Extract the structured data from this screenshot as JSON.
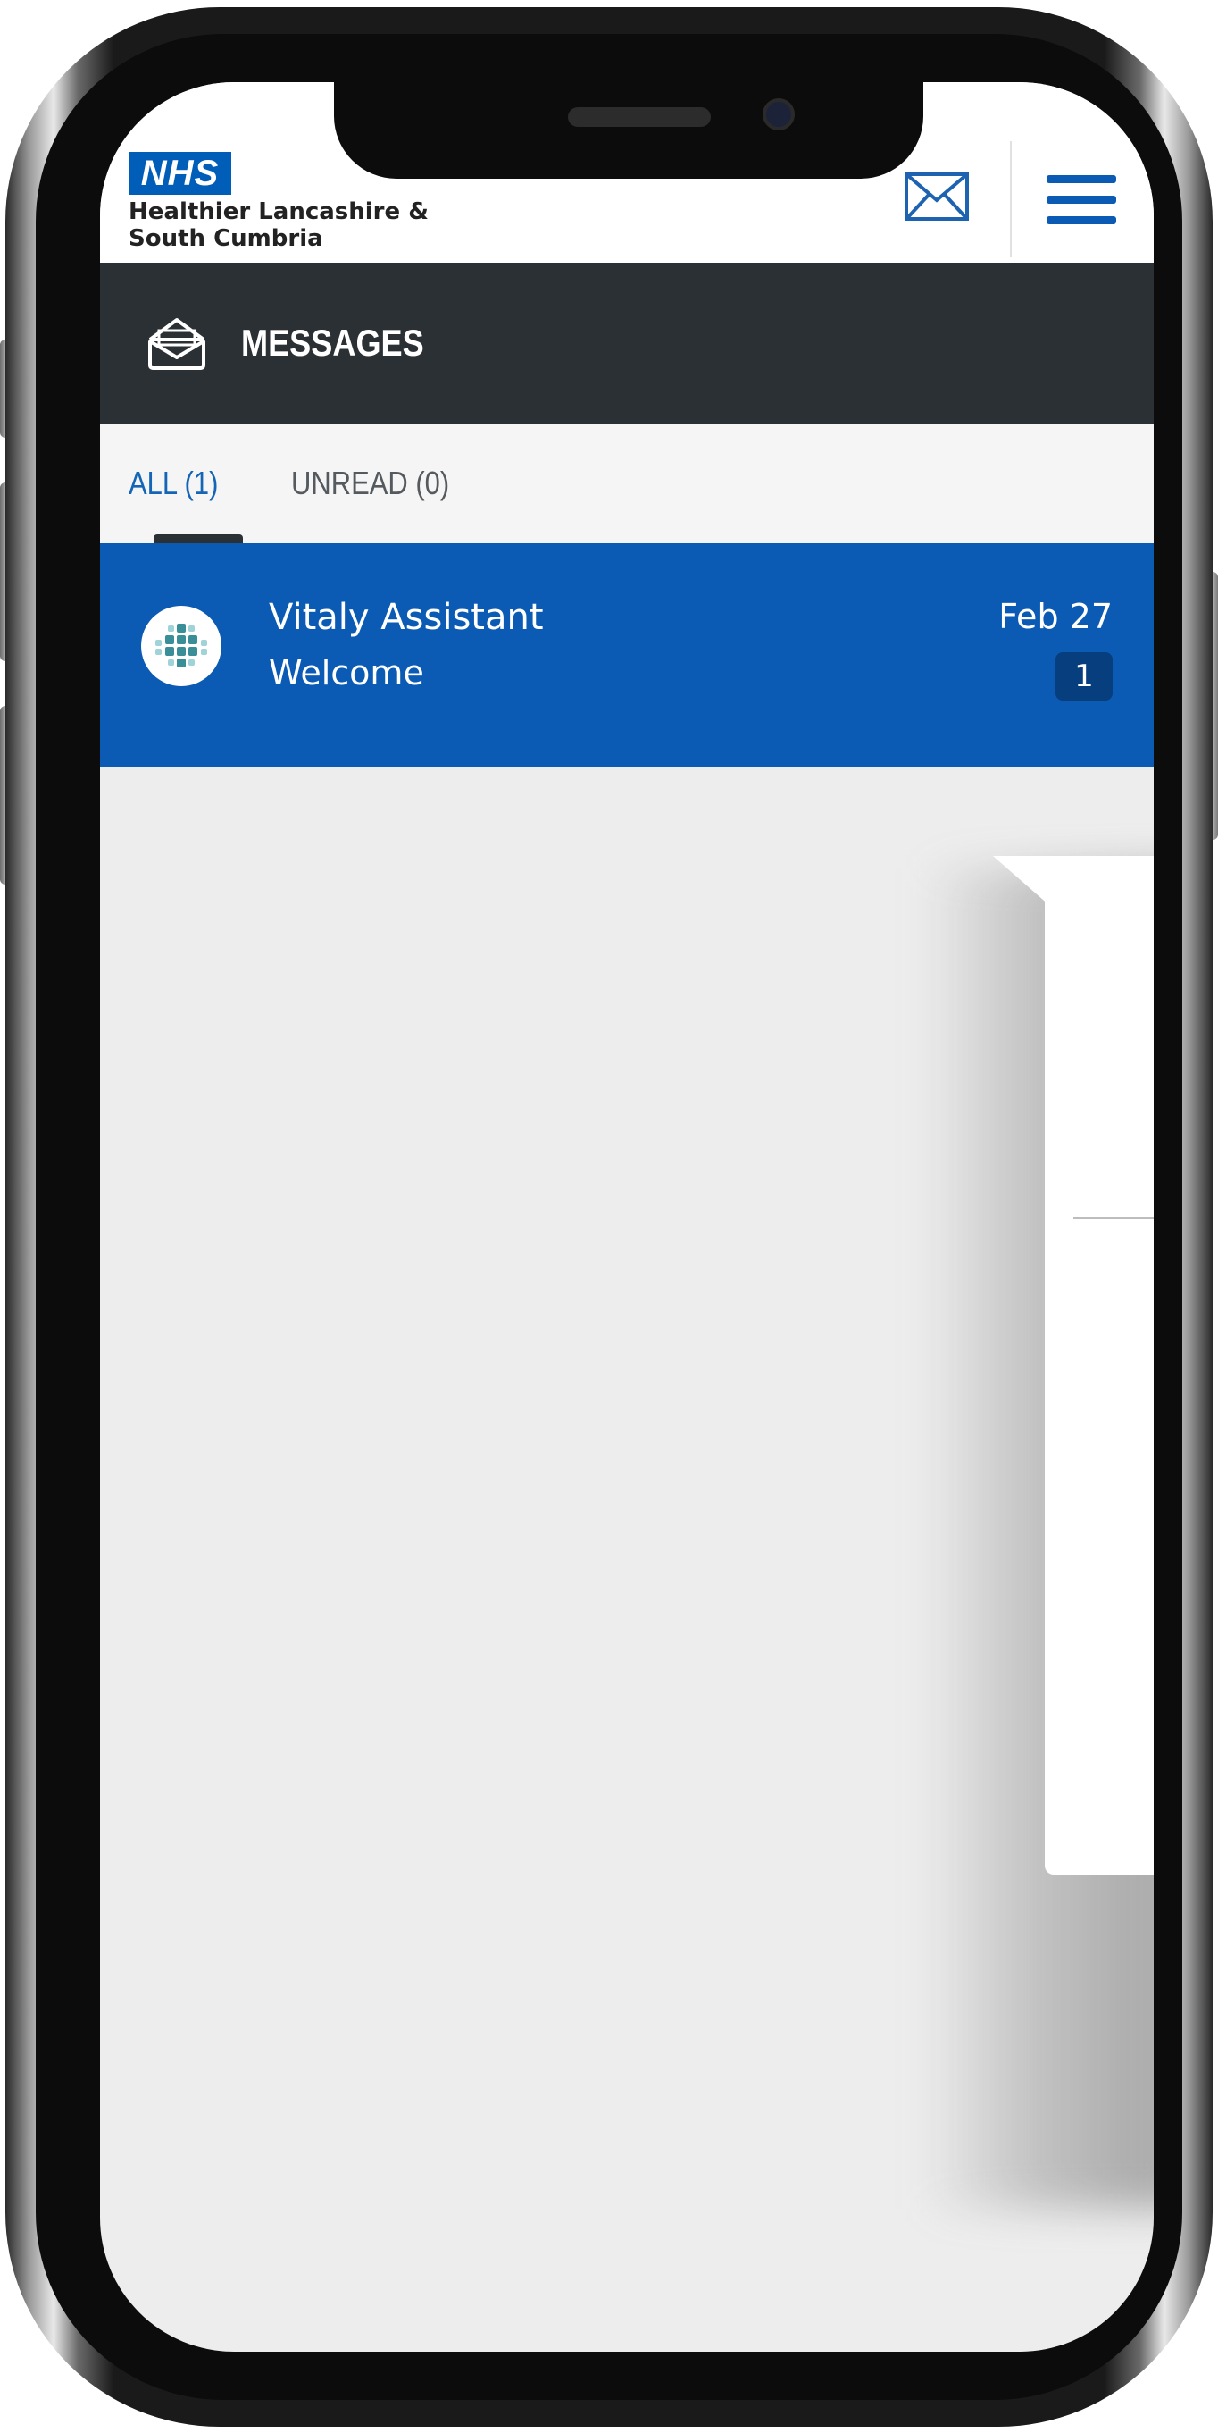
{
  "header": {
    "logo_text": "NHS",
    "org_name_line1": "Healthier Lancashire &",
    "org_name_line2": "South Cumbria",
    "mail_icon": "envelope-icon",
    "menu_icon": "hamburger-menu-icon"
  },
  "title_bar": {
    "icon": "open-envelope-icon",
    "title": "MESSAGES"
  },
  "tabs": [
    {
      "label": "ALL (1)",
      "active": true
    },
    {
      "label": "UNREAD (0)",
      "active": false
    }
  ],
  "messages": [
    {
      "sender": "Vitaly Assistant",
      "subject": "Welcome",
      "date": "Feb 27",
      "count": "1",
      "avatar_icon": "vitaly-logo-icon"
    }
  ],
  "colors": {
    "nhs_blue": "#005eb8",
    "title_bar": "#2b3035",
    "message_row": "#0b5bb5",
    "active_tab": "#1565b6",
    "count_badge": "#073e7e"
  }
}
